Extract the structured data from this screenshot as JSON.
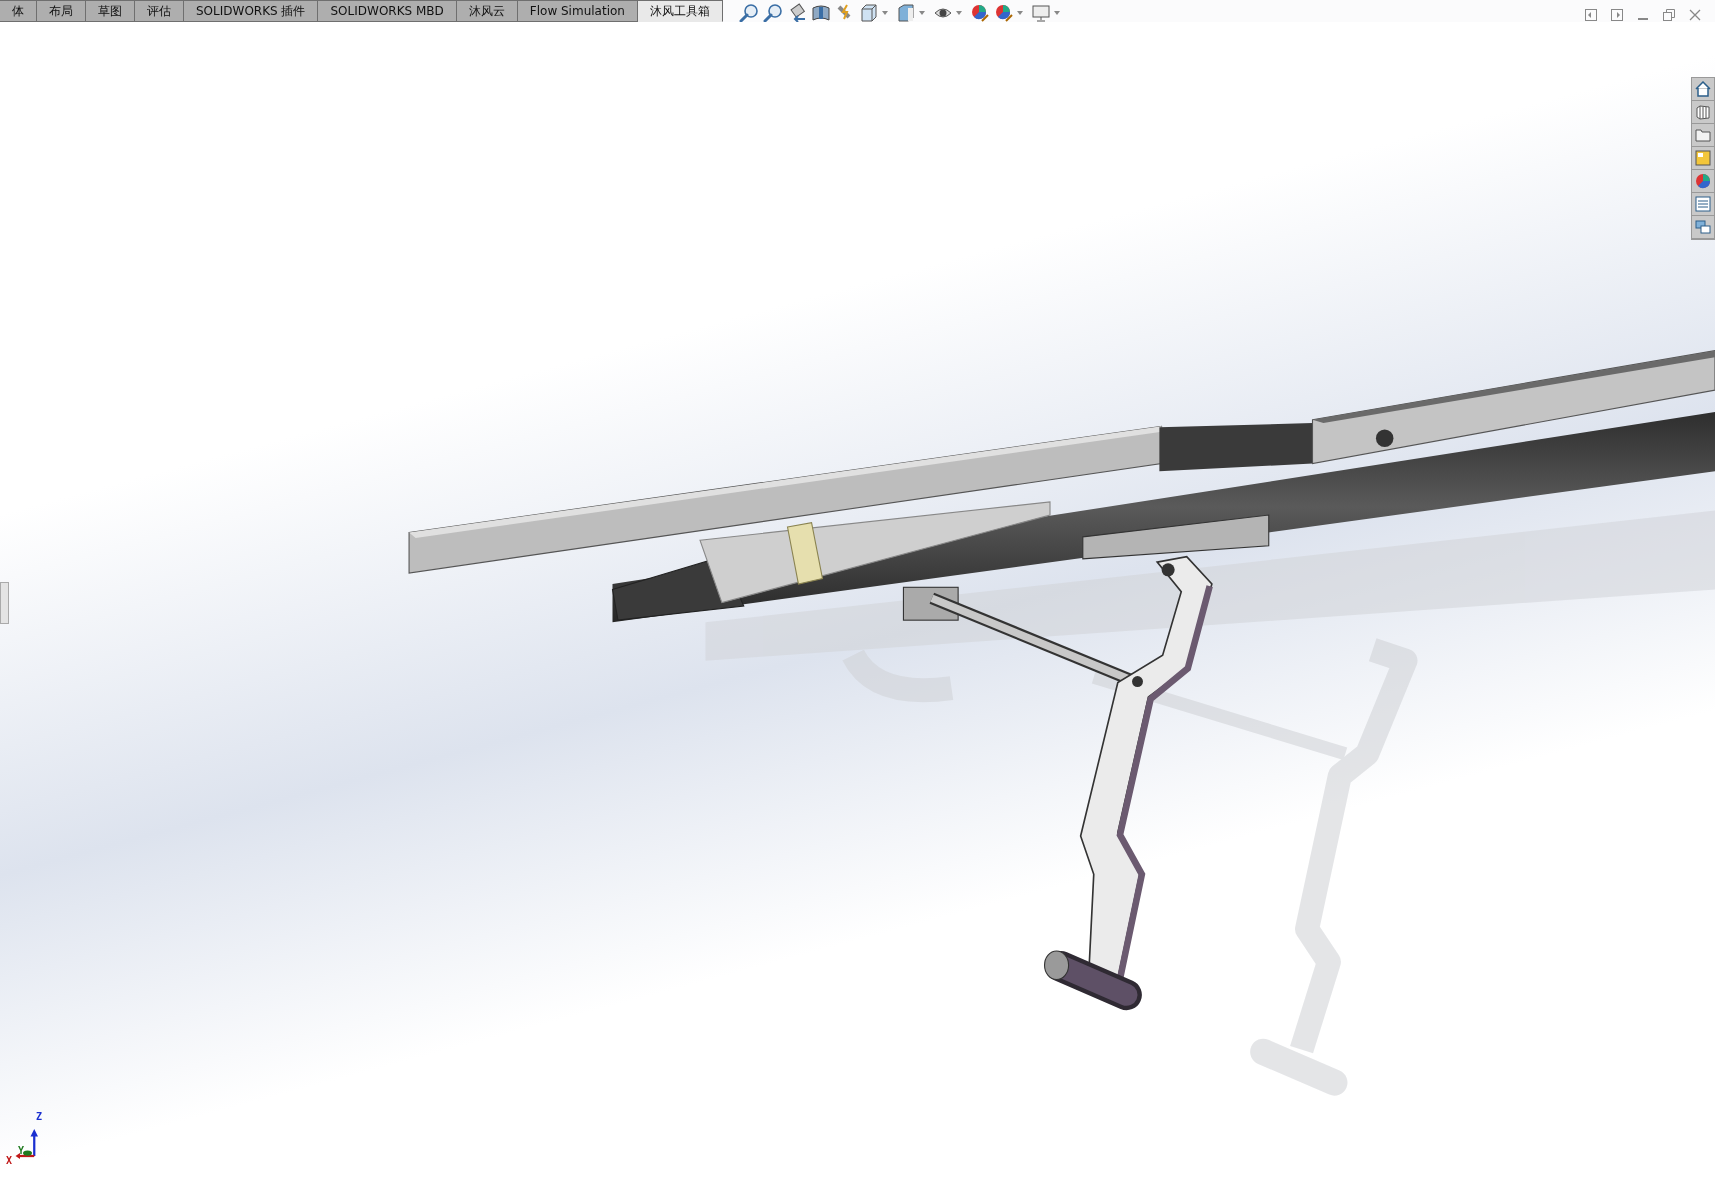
{
  "tabs": [
    {
      "label": "体",
      "selected": false
    },
    {
      "label": "布局",
      "selected": false
    },
    {
      "label": "草图",
      "selected": false
    },
    {
      "label": "评估",
      "selected": false
    },
    {
      "label": "SOLIDWORKS 插件",
      "selected": false
    },
    {
      "label": "SOLIDWORKS MBD",
      "selected": false
    },
    {
      "label": "沐风云",
      "selected": false
    },
    {
      "label": "Flow Simulation",
      "selected": false
    },
    {
      "label": "沐风工具箱",
      "selected": true
    }
  ],
  "triad": {
    "z_label": "Z",
    "y_label": "Y",
    "x_label": "X"
  }
}
